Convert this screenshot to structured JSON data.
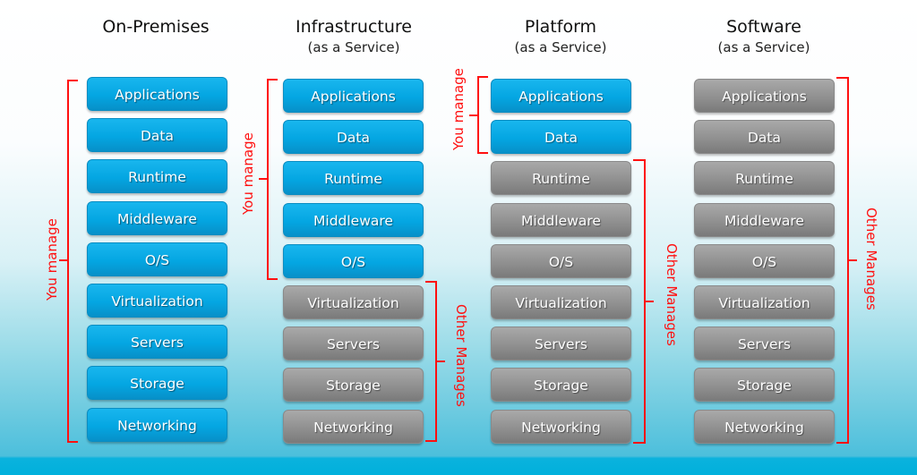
{
  "layers": [
    "Applications",
    "Data",
    "Runtime",
    "Middleware",
    "O/S",
    "Virtualization",
    "Servers",
    "Storage",
    "Networking"
  ],
  "columns": [
    {
      "title": "On-Premises",
      "subtitle": "",
      "you_manage_count": 9,
      "labels": {
        "you": "You manage",
        "other": ""
      }
    },
    {
      "title": "Infrastructure",
      "subtitle": "(as a Service)",
      "you_manage_count": 5,
      "labels": {
        "you": "You manage",
        "other": "Other Manages"
      }
    },
    {
      "title": "Platform",
      "subtitle": "(as a Service)",
      "you_manage_count": 2,
      "labels": {
        "you": "You manage",
        "other": "Other Manages"
      }
    },
    {
      "title": "Software",
      "subtitle": "(as a Service)",
      "you_manage_count": 0,
      "labels": {
        "you": "",
        "other": "Other Manages"
      }
    }
  ],
  "colors": {
    "you_manage": "#04a6e2",
    "other_manages": "#909090",
    "bracket": "#ff1010"
  }
}
